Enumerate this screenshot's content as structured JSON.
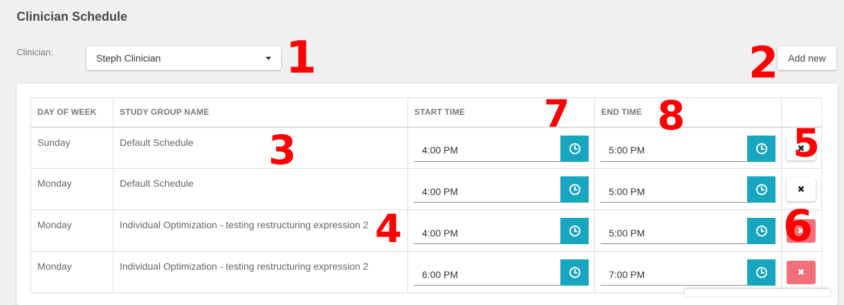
{
  "page": {
    "title": "Clinician Schedule"
  },
  "clinician": {
    "label": "Clinician:",
    "selected": "Steph Clinician"
  },
  "toolbar": {
    "add_new_label": "Add new"
  },
  "table": {
    "headers": {
      "day": "DAY OF WEEK",
      "group": "STUDY GROUP NAME",
      "start": "START TIME",
      "end": "END TIME"
    },
    "rows": [
      {
        "day": "Sunday",
        "group": "Default Schedule",
        "start": "4:00 PM",
        "end": "5:00 PM",
        "delete_style": "default"
      },
      {
        "day": "Monday",
        "group": "Default Schedule",
        "start": "4:00 PM",
        "end": "5:00 PM",
        "delete_style": "default"
      },
      {
        "day": "Monday",
        "group": "Individual Optimization - testing restructuring expression 2",
        "start": "4:00 PM",
        "end": "5:00 PM",
        "delete_style": "danger"
      },
      {
        "day": "Monday",
        "group": "Individual Optimization - testing restructuring expression 2",
        "start": "6:00 PM",
        "end": "7:00 PM",
        "delete_style": "danger"
      }
    ],
    "delete_glyph": "✖"
  },
  "annotations": [
    "1",
    "2",
    "3",
    "4",
    "5",
    "6",
    "7",
    "8"
  ],
  "icons": {
    "clock": "clock-icon",
    "delete": "close-icon",
    "dropdown": "caret-down-icon"
  },
  "colors": {
    "accent": "#18a6bf",
    "danger": "#f2707a",
    "annotation": "#ff0000"
  }
}
